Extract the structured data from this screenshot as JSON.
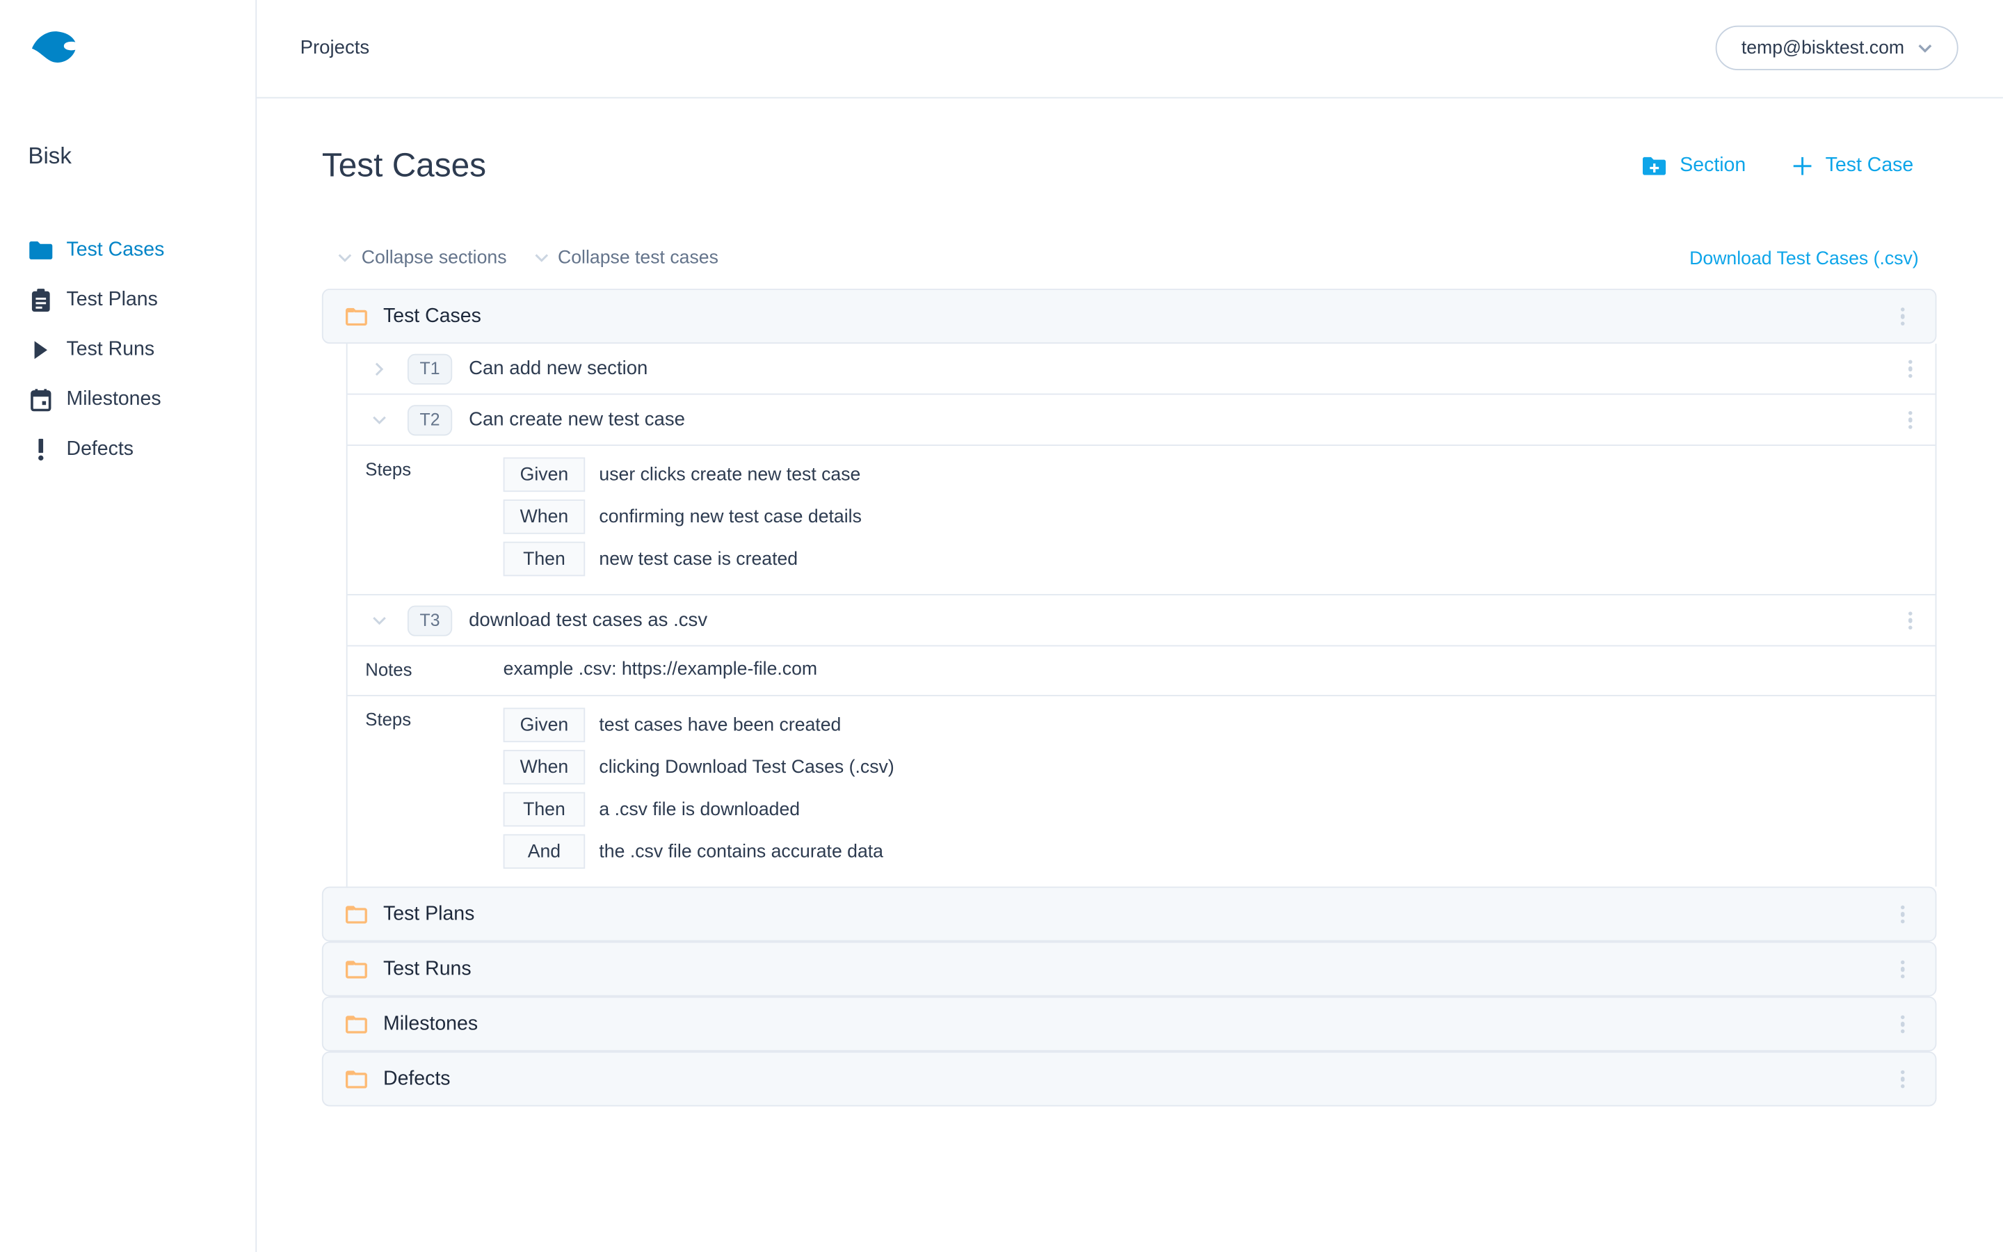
{
  "sidebar": {
    "logo": "bisk-logo",
    "project_name": "Bisk",
    "items": [
      {
        "label": "Test Cases",
        "icon": "folder-icon",
        "active": true
      },
      {
        "label": "Test Plans",
        "icon": "clipboard-icon",
        "active": false
      },
      {
        "label": "Test Runs",
        "icon": "play-icon",
        "active": false
      },
      {
        "label": "Milestones",
        "icon": "calendar-icon",
        "active": false
      },
      {
        "label": "Defects",
        "icon": "exclamation-icon",
        "active": false
      }
    ]
  },
  "header": {
    "projects_link": "Projects",
    "user_email": "temp@bisktest.com"
  },
  "main": {
    "title": "Test Cases",
    "add_section_label": "Section",
    "add_test_case_label": "Test Case",
    "collapse_sections_label": "Collapse sections",
    "collapse_test_cases_label": "Collapse test cases",
    "download_label": "Download Test Cases (.csv)",
    "sections": [
      {
        "title": "Test Cases",
        "cases": [
          {
            "id": "T1",
            "title": "Can add new section",
            "expanded": false
          },
          {
            "id": "T2",
            "title": "Can create new test case",
            "expanded": true,
            "steps_label": "Steps",
            "steps": [
              {
                "keyword": "Given",
                "text": "user clicks create new test case"
              },
              {
                "keyword": "When",
                "text": "confirming new test case details"
              },
              {
                "keyword": "Then",
                "text": "new test case is created"
              }
            ]
          },
          {
            "id": "T3",
            "title": "download test cases as .csv",
            "expanded": true,
            "notes_label": "Notes",
            "notes": "example .csv: https://example-file.com",
            "steps_label": "Steps",
            "steps": [
              {
                "keyword": "Given",
                "text": "test cases have been created"
              },
              {
                "keyword": "When",
                "text": "clicking Download Test Cases (.csv)"
              },
              {
                "keyword": "Then",
                "text": "a .csv file is downloaded"
              },
              {
                "keyword": "And",
                "text": "the .csv file contains accurate data"
              }
            ]
          }
        ]
      },
      {
        "title": "Test Plans"
      },
      {
        "title": "Test Runs"
      },
      {
        "title": "Milestones"
      },
      {
        "title": "Defects"
      }
    ]
  },
  "colors": {
    "brand": "#0284c7",
    "accent": "#0ea5e9",
    "folder": "#fdba74",
    "text": "#2d3b50"
  }
}
